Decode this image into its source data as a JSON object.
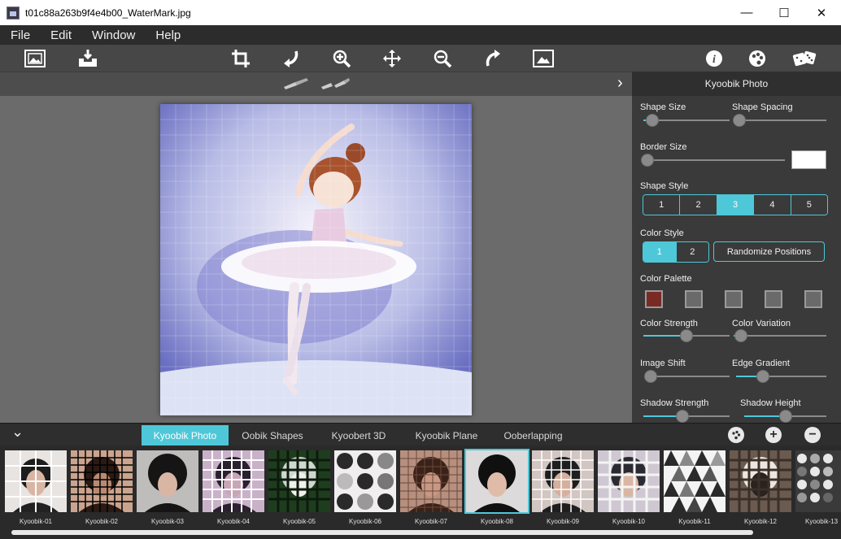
{
  "window": {
    "title": "t01c88a263b9f4e4b00_WaterMark.jpg",
    "minimize": "—",
    "maximize": "☐",
    "close": "✕"
  },
  "menu": [
    "File",
    "Edit",
    "Window",
    "Help"
  ],
  "toolbar_icons": [
    "open-image-icon",
    "save-download-icon",
    "crop-icon",
    "rotate-left-icon",
    "zoom-in-icon",
    "move-icon",
    "zoom-out-icon",
    "rotate-right-icon",
    "fit-image-icon",
    "info-icon",
    "palette-icon",
    "dice-icon"
  ],
  "subbar": {
    "expand": "›"
  },
  "panel": {
    "title": "Kyoobik Photo",
    "shape_size": {
      "label": "Shape Size",
      "value": 0.1
    },
    "shape_spacing": {
      "label": "Shape Spacing",
      "value": 0.06
    },
    "border_size": {
      "label": "Border Size",
      "value": 0.02
    },
    "shape_style": {
      "label": "Shape Style",
      "options": [
        "1",
        "2",
        "3",
        "4",
        "5"
      ],
      "selected": "3"
    },
    "color_style": {
      "label": "Color Style",
      "options": [
        "1",
        "2"
      ],
      "selected": "1"
    },
    "randomize": "Randomize Positions",
    "color_palette": {
      "label": "Color Palette",
      "swatches": [
        "#7a2a24",
        "#6a6a6a",
        "#6a6a6a",
        "#6a6a6a",
        "#6a6a6a"
      ]
    },
    "color_strength": {
      "label": "Color Strength",
      "value": 0.5
    },
    "color_variation": {
      "label": "Color Variation",
      "value": 0.08
    },
    "image_shift": {
      "label": "Image Shift",
      "value": 0.05
    },
    "edge_gradient": {
      "label": "Edge Gradient",
      "value": 0.3
    },
    "shadow_strength": {
      "label": "Shadow Strength",
      "value": 0.45
    },
    "shadow_height": {
      "label": "Shadow Height",
      "value": 0.5
    }
  },
  "tabs": {
    "collapse": "⌄",
    "items": [
      "Kyoobik Photo",
      "Oobik Shapes",
      "Kyoobert 3D",
      "Kyoobik Plane",
      "Ooberlapping"
    ],
    "selected": "Kyoobik Photo",
    "add": "+",
    "remove": "−"
  },
  "presets": [
    "Kyoobik-01",
    "Kyoobik-02",
    "Kyoobik-03",
    "Kyoobik-04",
    "Kyoobik-05",
    "Kyoobik-06",
    "Kyoobik-07",
    "Kyoobik-08",
    "Kyoobik-09",
    "Kyoobik-10",
    "Kyoobik-11",
    "Kyoobik-12",
    "Kyoobik-13"
  ],
  "selected_preset": "Kyoobik-08",
  "accent": "#4ec8d8"
}
